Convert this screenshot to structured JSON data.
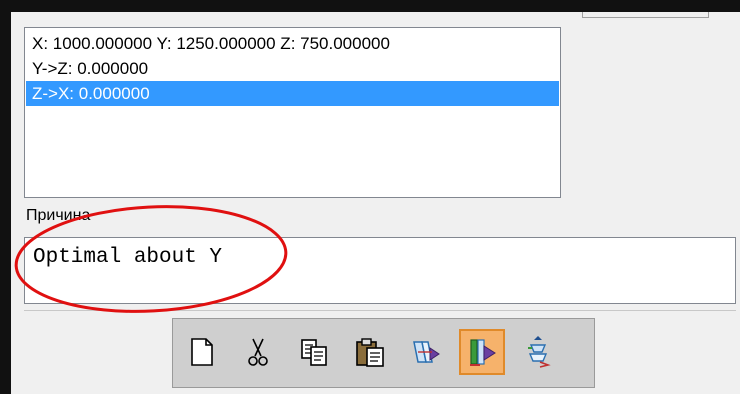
{
  "coords_list": {
    "items": [
      "X: 1000.000000 Y: 1250.000000 Z: 750.000000",
      "Y->Z: 0.000000",
      "Z->X: 0.000000"
    ],
    "selected_index": 2
  },
  "reason": {
    "label": "Причина",
    "value": "Optimal about Y"
  },
  "toolbar": {
    "buttons": [
      {
        "icon": "new-document-icon"
      },
      {
        "icon": "cut-icon"
      },
      {
        "icon": "copy-icon"
      },
      {
        "icon": "paste-icon"
      },
      {
        "icon": "transform-icon"
      },
      {
        "icon": "optimize-icon",
        "active": true
      },
      {
        "icon": "rotate-icon"
      }
    ]
  },
  "colors": {
    "selection": "#3399ff",
    "annotation": "#e01010",
    "active_button": "#f6b26b"
  }
}
